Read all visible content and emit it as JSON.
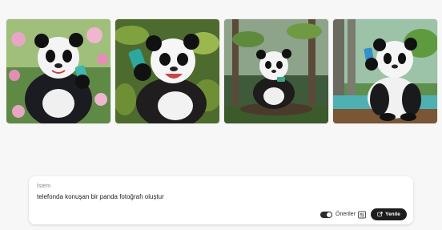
{
  "gallery": {
    "images": [
      {
        "alt": "panda-flowers",
        "selected": false
      },
      {
        "alt": "panda-jungle",
        "selected": true
      },
      {
        "alt": "panda-forest",
        "selected": false
      },
      {
        "alt": "panda-lake",
        "selected": false
      }
    ]
  },
  "prompt": {
    "label": "İstem",
    "value": "telefonda konuşan bir panda fotoğrafı oluştur"
  },
  "controls": {
    "suggestions_label": "Öneriler",
    "suggestions_on": true,
    "refresh_label": "Yenile"
  },
  "icons": {
    "suggestions": "settings-sliders-icon",
    "refresh": "refresh-icon"
  }
}
